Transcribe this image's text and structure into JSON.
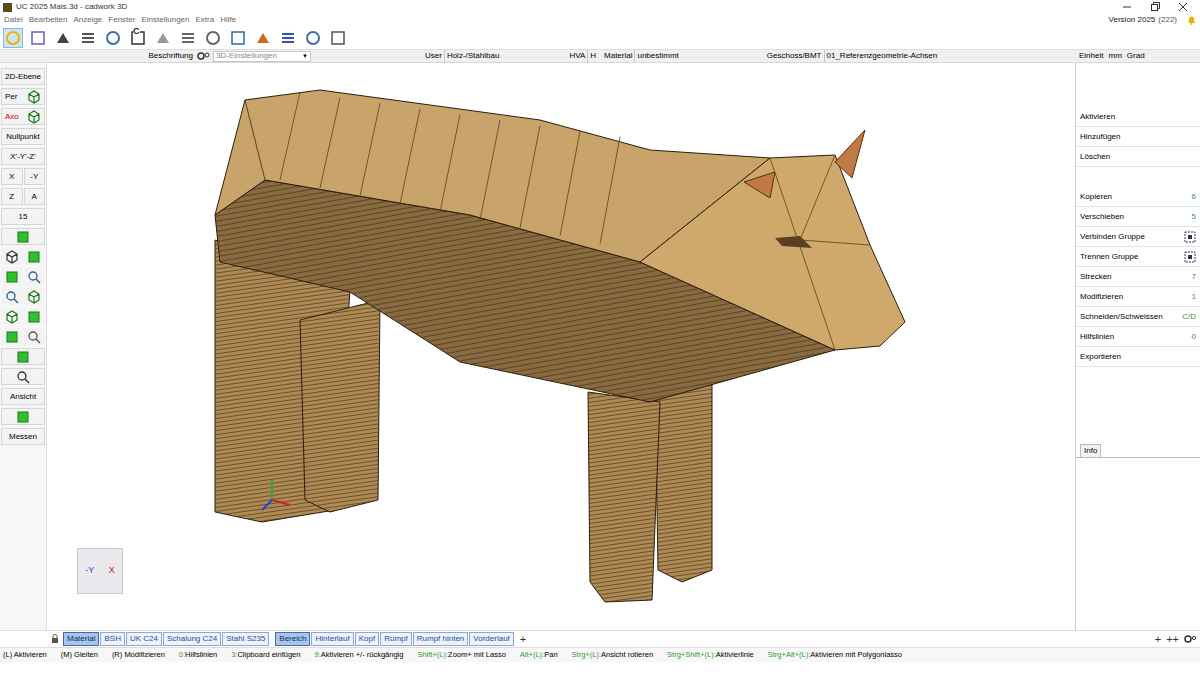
{
  "window": {
    "title": "UC 2025 Mais.3d - cadwork 3D",
    "version": "Version 2025",
    "build": "(222)"
  },
  "menu": [
    "Datei",
    "Bearbeiten",
    "Anzeige",
    "Fenster",
    "Einstellungen",
    "Extra",
    "Hilfe"
  ],
  "toolbar": [
    {
      "selected": true,
      "label": ""
    },
    {
      "selected": false,
      "label": ""
    },
    {
      "selected": false,
      "label": ""
    },
    {
      "selected": false,
      "label": ""
    },
    {
      "selected": false,
      "label": ""
    },
    {
      "selected": false,
      "label": "C"
    },
    {
      "selected": false,
      "label": ""
    },
    {
      "selected": false,
      "label": ""
    },
    {
      "selected": false,
      "label": ""
    },
    {
      "selected": false,
      "label": ""
    },
    {
      "selected": false,
      "label": ""
    },
    {
      "selected": false,
      "label": ""
    },
    {
      "selected": false,
      "label": ""
    },
    {
      "selected": false,
      "label": ""
    }
  ],
  "info_bar": {
    "label": "Beschriftung",
    "view": "3D-Einstellungen",
    "fields": [
      {
        "label": "User",
        "value": "Holz-/Stahlbau"
      },
      {
        "label": "HVA",
        "value": "H"
      },
      {
        "label": "Material",
        "value": "unbestimmt"
      },
      {
        "label": "Geschoss/BMT",
        "value": "01_Referenzgeometrie-Achsen"
      }
    ],
    "unit": {
      "label": "Einheit",
      "values": [
        "mm",
        "Grad"
      ]
    }
  },
  "left_toolbar": [
    {
      "kind": "text",
      "label": "2D-Ebene"
    },
    {
      "kind": "label-icon",
      "label": "Per",
      "color": "#000000"
    },
    {
      "kind": "label-icon",
      "label": "Axo",
      "color": "#cc0000"
    },
    {
      "kind": "text",
      "label": "Nullpunkt"
    },
    {
      "kind": "text",
      "label": "X'-Y'-Z'"
    },
    {
      "kind": "pair",
      "labels": [
        "X",
        "-Y"
      ]
    },
    {
      "kind": "pair",
      "labels": [
        "Z",
        "A"
      ]
    },
    {
      "kind": "text",
      "label": "15"
    },
    {
      "kind": "icon"
    },
    {
      "kind": "icon2"
    },
    {
      "kind": "icon2"
    },
    {
      "kind": "icon2"
    },
    {
      "kind": "icon2"
    },
    {
      "kind": "icon2"
    },
    {
      "kind": "icon"
    },
    {
      "kind": "icon"
    },
    {
      "kind": "text",
      "label": "Ansicht"
    },
    {
      "kind": "icon"
    },
    {
      "kind": "text",
      "label": "Messen"
    }
  ],
  "right_panel": [
    {
      "kind": "plain",
      "label": "Aktivieren"
    },
    {
      "kind": "plain",
      "label": "Hinzufügen"
    },
    {
      "kind": "plain",
      "label": "Löschen"
    },
    {
      "kind": "gap"
    },
    {
      "kind": "shortcut",
      "label": "Kopieren",
      "shortcut": "6"
    },
    {
      "kind": "shortcut",
      "label": "Verschieben",
      "shortcut": "5"
    },
    {
      "kind": "icon",
      "label": "Verbinden Gruppe"
    },
    {
      "kind": "icon",
      "label": "Trennen Gruppe"
    },
    {
      "kind": "shortcut",
      "label": "Strecken",
      "shortcut": "7"
    },
    {
      "kind": "shortcut",
      "label": "Modifizieren",
      "shortcut": "1"
    },
    {
      "kind": "shortcut",
      "label": "Schneiden/Schweissen",
      "shortcut": "C/D"
    },
    {
      "kind": "shortcut",
      "label": "Hilfslinien",
      "shortcut": "0"
    },
    {
      "kind": "plain",
      "label": "Exportieren"
    }
  ],
  "info_tab": "Info",
  "axis_cube": {
    "y_label": "-Y",
    "x_label": "X"
  },
  "tab_groups": [
    [
      {
        "label": "Material",
        "selected": true
      },
      {
        "label": "BSH",
        "selected": false
      },
      {
        "label": "UK C24",
        "selected": false
      },
      {
        "label": "Schalung C24",
        "selected": false
      },
      {
        "label": "Stahl S235",
        "selected": false
      }
    ],
    [
      {
        "label": "Bereich",
        "selected": true
      },
      {
        "label": "Hinterlauf",
        "selected": false
      },
      {
        "label": "Kopf",
        "selected": false
      },
      {
        "label": "Rumpf",
        "selected": false
      },
      {
        "label": "Rumpf hinten",
        "selected": false
      },
      {
        "label": "Vorderlauf",
        "selected": false
      }
    ]
  ],
  "tab_add": "+",
  "tab_right": [
    "+",
    "++"
  ],
  "status_hints": [
    {
      "key": "(L) ",
      "action": "Aktivieren",
      "color": "#000000"
    },
    {
      "key": "(M) ",
      "action": "Gleiten",
      "color": "#000000"
    },
    {
      "key": "(R) ",
      "action": "Modifizieren",
      "color": "#000000"
    },
    {
      "key": "0:",
      "action": "Hilfslinien",
      "color": "#2e9e2e"
    },
    {
      "key": "3:",
      "action": "Clipboard einfügen",
      "color": "#2e9e2e"
    },
    {
      "key": "9:",
      "action": "Aktivieren +/- rückgängig",
      "color": "#2e9e2e"
    },
    {
      "key": "Shift+(L):",
      "action": "Zoom+ mit Lasso",
      "color": "#2e9e2e"
    },
    {
      "key": "Alt+(L):",
      "action": "Pan",
      "color": "#2e9e2e"
    },
    {
      "key": "Strg+(L):",
      "action": "Ansicht rotieren",
      "color": "#2e9e2e"
    },
    {
      "key": "Strg+Shift+(L):",
      "action": "Aktivierlinie",
      "color": "#2e9e2e"
    },
    {
      "key": "Strg+Alt+(L):",
      "action": "Aktivieren mit Polygonlasso",
      "color": "#2e9e2e"
    }
  ]
}
